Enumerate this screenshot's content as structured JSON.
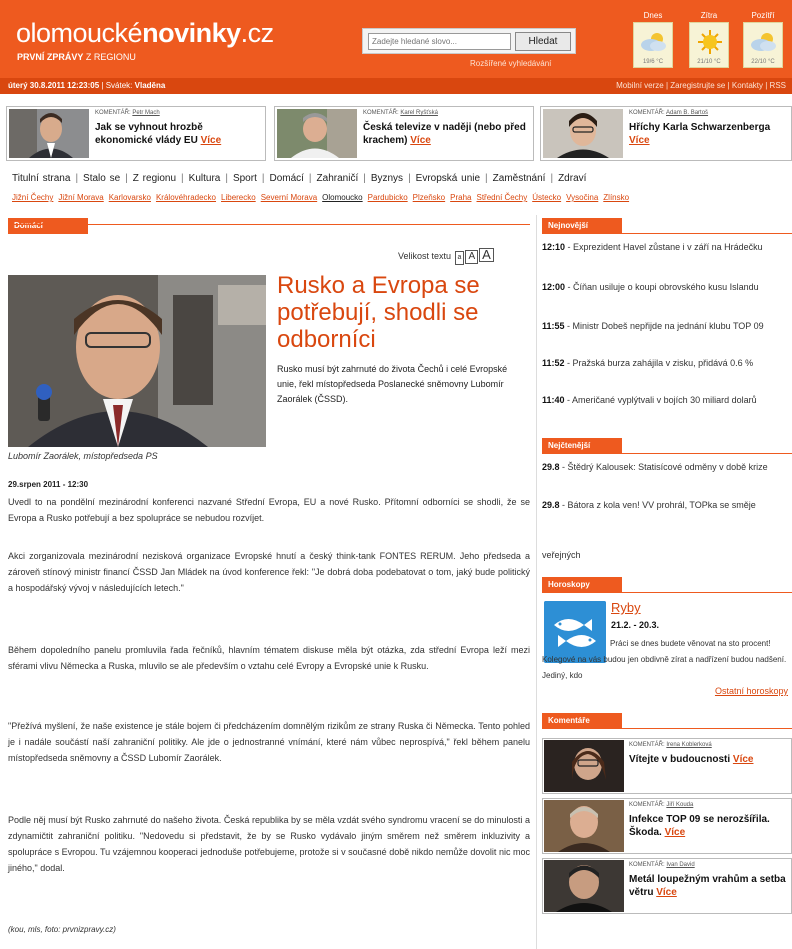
{
  "header": {
    "logo_light": "olomoucké",
    "logo_bold": "novinky",
    "logo_tld": ".cz",
    "tagline_bold": "PRVNÍ ZPRÁVY",
    "tagline_rest": " Z REGIONU",
    "search_placeholder": "Zadejte hledané slovo...",
    "search_button": "Hledat",
    "advanced_search": "Rozšířené vyhledávání",
    "weather": [
      {
        "label": "Dnes",
        "temp": "19/6 °C",
        "icon": "cloud-sun-icon"
      },
      {
        "label": "Zítra",
        "temp": "21/10 °C",
        "icon": "sun-icon"
      },
      {
        "label": "Pozítří",
        "temp": "22/10 °C",
        "icon": "cloud-sun-icon"
      }
    ]
  },
  "subbar": {
    "date": "úterý 30.8.2011 12:23:05",
    "nameday_prefix": "Svátek:",
    "nameday_name": "Vladěna",
    "links": "Mobilní verze | Zaregistrujte se | Kontakty | RSS"
  },
  "commentaries": [
    {
      "tag": "KOMENTÁŘ:",
      "author": "Petr Mach",
      "title": "Jak se vyhnout hrozbě ekonomické vlády EU",
      "more": "Více"
    },
    {
      "tag": "KOMENTÁŘ:",
      "author": "Karel Ryšťská",
      "title": "Česká televize v naději (nebo před krachem)",
      "more": "Více"
    },
    {
      "tag": "KOMENTÁŘ:",
      "author": "Adam B. Bartoš",
      "title": "Hříchy Karla Schwarzenberga",
      "more": "Více"
    }
  ],
  "nav_main": [
    "Titulní strana",
    "Stalo se",
    "Z regionu",
    "Kultura",
    "Sport",
    "Domácí",
    "Zahraničí",
    "Byznys",
    "Evropská unie",
    "Zaměstnání",
    "Zdraví"
  ],
  "nav_regions": [
    "Jižní Čechy",
    "Jižní Morava",
    "Karlovarsko",
    "Královéhradecko",
    "Liberecko",
    "Severní Morava",
    "Olomoucko",
    "Pardubicko",
    "Plzeňsko",
    "Praha",
    "Střední Čechy",
    "Ústecko",
    "Vysočina",
    "Zlínsko"
  ],
  "nav_regions_active": "Olomoucko",
  "article": {
    "section": "Domácí",
    "textsize_label": "Velikost textu",
    "textsize_options": [
      "a",
      "A",
      "A"
    ],
    "headline": "Rusko a Evropa se potřebují, shodli se odborníci",
    "lead": "Rusko musí být zahrnuté do života Čechů i celé Evropské unie, řekl místopředseda Poslanecké sněmovny Lubomír Zaorálek (ČSSD).",
    "photo_caption": "Lubomír Zaorálek, místopředseda PS",
    "dateline": "29.srpen 2011 - 12:30",
    "paragraphs": [
      "Uvedl to na pondělní mezinárodní konferenci nazvané Střední Evropa, EU a nové Rusko. Přítomní odborníci se shodli, že se Evropa a Rusko potřebují a bez spolupráce se nebudou rozvíjet.",
      "Akci zorganizovala mezinárodní nezisková organizace Evropské hnutí a český think-tank FONTES RERUM. Jeho předseda a zároveň stínový ministr financí ČSSD Jan Mládek na úvod konference řekl: \"Je dobrá doba podebatovat o tom, jaký bude politický a hospodářský vývoj v následujících letech.\"",
      "Během dopoledního panelu promluvila řada řečníků, hlavním tématem diskuse měla být otázka, zda střední Evropa leží mezi sférami vlivu Německa a Ruska, mluvilo se ale především o vztahu celé Evropy a Evropské unie k Rusku.",
      "\"Přežívá myšlení, že naše existence je stále bojem či předcházením domnělým rizikům ze strany Ruska či Německa. Tento pohled je i nadále součástí naší zahraniční politiky. Ale jde o jednostranné vnímání, které nám vůbec neprospívá,\" řekl během panelu místopředseda sněmovny a ČSSD Lubomír Zaorálek.",
      "Podle něj musí být Rusko zahrnuté do našeho života. Česká republika by se měla vzdát svého syndromu vracení se do minulosti a zdynamičtit zahraniční politiku. \"Nedovedu si představit, že by se Rusko vydávalo jiným směrem než směrem inkluzivity a spolupráce s Evropou. Tu vzájemnou kooperaci jednoduše potřebujeme, protože si v současné době nikdo nemůže dovolit nic moc jiného,\" dodal."
    ],
    "credit": "(kou, mls, foto: prvnizpravy.cz)"
  },
  "sidebar": {
    "newest_title": "Nejnovější",
    "newest": [
      {
        "time": "12:10",
        "text": "Exprezident Havel zůstane i v září na Hrádečku"
      },
      {
        "time": "12:00",
        "text": "Číňan usiluje o koupi obrovského kusu Islandu"
      },
      {
        "time": "11:55",
        "text": "Ministr Dobeš nepřijde na jednání klubu TOP 09"
      },
      {
        "time": "11:52",
        "text": "Pražská burza zahájila v zisku, přidává 0.6 %"
      },
      {
        "time": "11:40",
        "text": "Američané vyplýtvali v bojích 30 miliard dolarů"
      }
    ],
    "read_title": "Nejčtenější",
    "read": [
      {
        "date": "29.8",
        "text": "Štědrý Kalousek: Statisícové odměny v době krize"
      },
      {
        "date": "29.8",
        "text": "Bátora z kola ven! VV prohrál, TOPka se směje"
      }
    ],
    "read_tail": "veřejných",
    "horoscope_title": "Horoskopy",
    "horoscope_sign": "Ryby",
    "horoscope_dates": "21.2. - 20.3.",
    "horoscope_text": "Práci se dnes budete věnovat na sto procent! Kolegové na vás budou jen obdivně zírat a nadřízení budou nadšení. Jediný, kdo",
    "horoscope_more": "Ostatní horoskopy",
    "comments_title": "Komentáře",
    "comments": [
      {
        "tag": "KOMENTÁŘ:",
        "author": "Irena Koblerková",
        "title": "Vítejte v budoucnosti",
        "more": "Více"
      },
      {
        "tag": "KOMENTÁŘ:",
        "author": "Jiří Kouda",
        "title": "Infekce TOP 09 se nerozšířila. Škoda.",
        "more": "Více"
      },
      {
        "tag": "KOMENTÁŘ:",
        "author": "Ivan David",
        "title": "Metál loupežným vrahům a setba větru",
        "more": "Více"
      }
    ]
  }
}
